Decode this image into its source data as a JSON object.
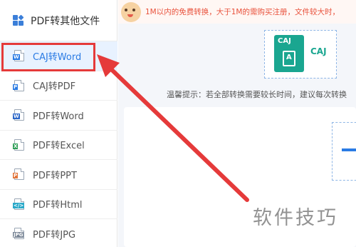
{
  "sidebar": {
    "title": "PDF转其他文件",
    "items": [
      {
        "label": "CAJ转Word",
        "icon": "caj-word-file-icon",
        "active": true
      },
      {
        "label": "CAJ转PDF",
        "icon": "caj-pdf-file-icon",
        "active": false
      },
      {
        "label": "PDF转Word",
        "icon": "word-file-icon",
        "active": false
      },
      {
        "label": "PDF转Excel",
        "icon": "excel-file-icon",
        "active": false
      },
      {
        "label": "PDF转PPT",
        "icon": "ppt-file-icon",
        "active": false
      },
      {
        "label": "PDF转Html",
        "icon": "html-file-icon",
        "active": false
      },
      {
        "label": "PDF转JPG",
        "icon": "jpg-file-icon",
        "active": false
      }
    ]
  },
  "notice": {
    "text": "1M以内的免费转换，大于1M的需购买注册，文件较大时，"
  },
  "main": {
    "caj_badge": "CAJ",
    "caj_title": "CAJ",
    "tip": "温馨提示：若全部转换需要较长时间，建议每次转换"
  },
  "watermark": "软件技巧",
  "colors": {
    "accent": "#2a7be4",
    "highlight_box": "#e53a3a",
    "notice_text": "#e9523c",
    "caj_green": "#1aa690"
  }
}
